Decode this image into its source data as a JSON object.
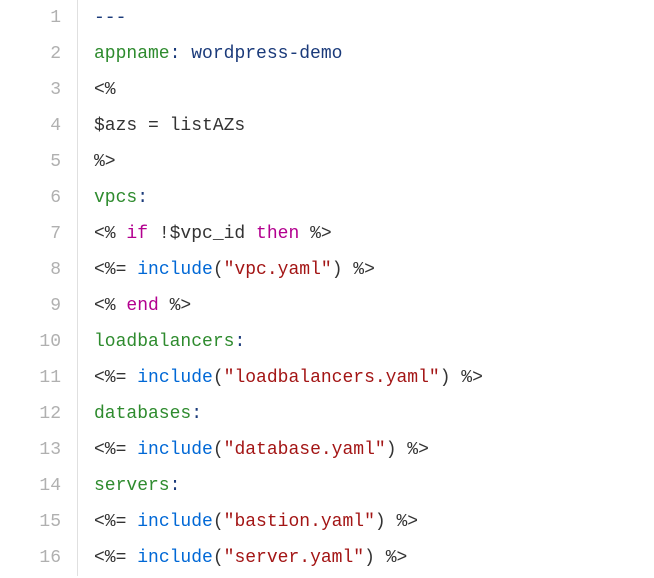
{
  "lines": [
    {
      "num": "1",
      "tokens": [
        {
          "cls": "tok-darkblue",
          "text": "---"
        }
      ]
    },
    {
      "num": "2",
      "tokens": [
        {
          "cls": "tok-green",
          "text": "appname"
        },
        {
          "cls": "tok-darkblue",
          "text": ": "
        },
        {
          "cls": "tok-darkblue",
          "text": "wordpress-demo"
        }
      ]
    },
    {
      "num": "3",
      "tokens": [
        {
          "cls": "tok-plain",
          "text": "<%"
        }
      ]
    },
    {
      "num": "4",
      "tokens": [
        {
          "cls": "tok-plain",
          "text": "$azs = listAZs"
        }
      ]
    },
    {
      "num": "5",
      "tokens": [
        {
          "cls": "tok-plain",
          "text": "%>"
        }
      ]
    },
    {
      "num": "6",
      "tokens": [
        {
          "cls": "tok-green",
          "text": "vpcs"
        },
        {
          "cls": "tok-darkblue",
          "text": ":"
        }
      ]
    },
    {
      "num": "7",
      "tokens": [
        {
          "cls": "tok-plain",
          "text": "<% "
        },
        {
          "cls": "tok-magenta",
          "text": "if"
        },
        {
          "cls": "tok-plain",
          "text": " !$vpc_id "
        },
        {
          "cls": "tok-magenta",
          "text": "then"
        },
        {
          "cls": "tok-plain",
          "text": " %>"
        }
      ]
    },
    {
      "num": "8",
      "tokens": [
        {
          "cls": "tok-plain",
          "text": "<%= "
        },
        {
          "cls": "tok-blue",
          "text": "include"
        },
        {
          "cls": "tok-plain",
          "text": "("
        },
        {
          "cls": "tok-maroon",
          "text": "\"vpc.yaml\""
        },
        {
          "cls": "tok-plain",
          "text": ") %>"
        }
      ]
    },
    {
      "num": "9",
      "tokens": [
        {
          "cls": "tok-plain",
          "text": "<% "
        },
        {
          "cls": "tok-magenta",
          "text": "end"
        },
        {
          "cls": "tok-plain",
          "text": " %>"
        }
      ]
    },
    {
      "num": "10",
      "tokens": [
        {
          "cls": "tok-green",
          "text": "loadbalancers"
        },
        {
          "cls": "tok-darkblue",
          "text": ":"
        }
      ]
    },
    {
      "num": "11",
      "tokens": [
        {
          "cls": "tok-plain",
          "text": "<%= "
        },
        {
          "cls": "tok-blue",
          "text": "include"
        },
        {
          "cls": "tok-plain",
          "text": "("
        },
        {
          "cls": "tok-maroon",
          "text": "\"loadbalancers.yaml\""
        },
        {
          "cls": "tok-plain",
          "text": ") %>"
        }
      ]
    },
    {
      "num": "12",
      "tokens": [
        {
          "cls": "tok-green",
          "text": "databases"
        },
        {
          "cls": "tok-darkblue",
          "text": ":"
        }
      ]
    },
    {
      "num": "13",
      "tokens": [
        {
          "cls": "tok-plain",
          "text": "<%= "
        },
        {
          "cls": "tok-blue",
          "text": "include"
        },
        {
          "cls": "tok-plain",
          "text": "("
        },
        {
          "cls": "tok-maroon",
          "text": "\"database.yaml\""
        },
        {
          "cls": "tok-plain",
          "text": ") %>"
        }
      ]
    },
    {
      "num": "14",
      "tokens": [
        {
          "cls": "tok-green",
          "text": "servers"
        },
        {
          "cls": "tok-darkblue",
          "text": ":"
        }
      ]
    },
    {
      "num": "15",
      "tokens": [
        {
          "cls": "tok-plain",
          "text": "<%= "
        },
        {
          "cls": "tok-blue",
          "text": "include"
        },
        {
          "cls": "tok-plain",
          "text": "("
        },
        {
          "cls": "tok-maroon",
          "text": "\"bastion.yaml\""
        },
        {
          "cls": "tok-plain",
          "text": ") %>"
        }
      ]
    },
    {
      "num": "16",
      "tokens": [
        {
          "cls": "tok-plain",
          "text": "<%= "
        },
        {
          "cls": "tok-blue",
          "text": "include"
        },
        {
          "cls": "tok-plain",
          "text": "("
        },
        {
          "cls": "tok-maroon",
          "text": "\"server.yaml\""
        },
        {
          "cls": "tok-plain",
          "text": ") %>"
        }
      ]
    }
  ]
}
